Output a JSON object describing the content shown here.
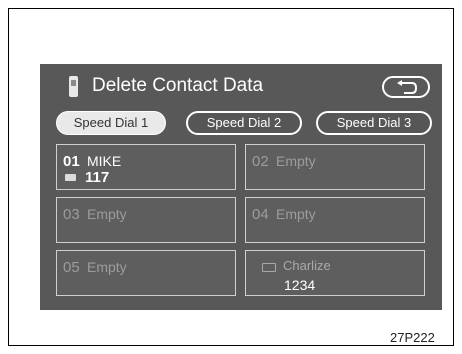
{
  "header": {
    "title": "Delete Contact Data",
    "icons": {
      "phone": "phone-icon",
      "back": "back-arrow-icon"
    }
  },
  "tabs": [
    {
      "label": "Speed Dial 1",
      "active": true
    },
    {
      "label": "Speed Dial 2",
      "active": false
    },
    {
      "label": "Speed Dial 3",
      "active": false
    }
  ],
  "entries": [
    {
      "slot": "01",
      "name": "MIKE",
      "value": "117"
    },
    {
      "slot": "02",
      "name": "Empty",
      "value": ""
    },
    {
      "slot": "03",
      "name": "Empty",
      "value": ""
    },
    {
      "slot": "04",
      "name": "Empty",
      "value": ""
    },
    {
      "slot": "05",
      "name": "Empty",
      "value": ""
    },
    {
      "slot": "",
      "name": "Charlize",
      "value": "1234"
    }
  ],
  "caption": "27P222",
  "colors": {
    "screen": "#585858",
    "border": "#cfcfcf",
    "empty_text": "#9c9c9c"
  }
}
